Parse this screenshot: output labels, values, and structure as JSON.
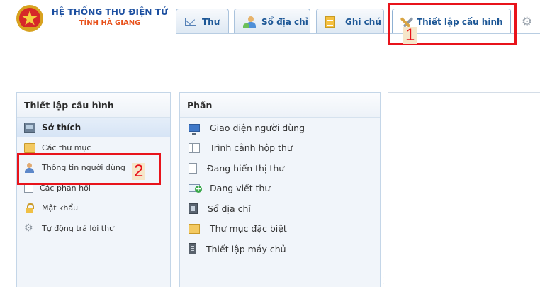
{
  "header": {
    "title_line1": "HỆ THỐNG THƯ ĐIỆN TỬ",
    "title_line2": "TỈNH HÀ GIANG",
    "logo_icon": "national-emblem-icon"
  },
  "tabs": [
    {
      "label": "Thư",
      "icon": "mail-icon"
    },
    {
      "label": "Sổ địa chỉ",
      "icon": "contacts-icon"
    },
    {
      "label": "Ghi chú",
      "icon": "note-icon"
    },
    {
      "label": "Thiết lập cấu hình",
      "icon": "settings-wrench-icon",
      "active": true
    }
  ],
  "annotations": [
    {
      "number": "1",
      "color": "#e8131b"
    },
    {
      "number": "2",
      "color": "#e8131b"
    }
  ],
  "left_panel": {
    "title": "Thiết lập cấu hình",
    "items": [
      {
        "label": "Sở thích",
        "icon": "preferences-icon",
        "selected": true
      },
      {
        "label": "Các thư mục",
        "icon": "folder-icon"
      },
      {
        "label": "Thông tin người dùng",
        "icon": "user-icon"
      },
      {
        "label": "Các phản hồi",
        "icon": "document-icon"
      },
      {
        "label": "Mật khẩu",
        "icon": "lock-icon"
      },
      {
        "label": "Tự động trả lời thư",
        "icon": "gear-icon"
      }
    ]
  },
  "middle_panel": {
    "title": "Phần",
    "items": [
      {
        "label": "Giao diện người dùng",
        "icon": "monitor-icon"
      },
      {
        "label": "Trình cảnh hộp thư",
        "icon": "layout-icon"
      },
      {
        "label": "Đang hiển thị thư",
        "icon": "page-icon"
      },
      {
        "label": "Đang viết thư",
        "icon": "compose-icon"
      },
      {
        "label": "Sổ địa chỉ",
        "icon": "address-book-icon"
      },
      {
        "label": "Thư mục đặc biệt",
        "icon": "special-folder-icon"
      },
      {
        "label": "Thiết lập máy chủ",
        "icon": "server-icon"
      }
    ]
  },
  "colors": {
    "brand_blue": "#1c4fa0",
    "brand_orange": "#e8521c",
    "tab_text": "#1d5796",
    "annotation_red": "#e8131b"
  }
}
